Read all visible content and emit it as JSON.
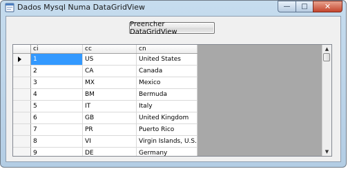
{
  "window": {
    "title": "Dados Mysql Numa DataGridView",
    "minimize_glyph": "—",
    "maximize_glyph": "□",
    "close_glyph": "✕"
  },
  "toolbar": {
    "fill_button_label": "Preencher DataGridView"
  },
  "grid": {
    "columns": [
      "ci",
      "cc",
      "cn"
    ],
    "current_row_index": 0,
    "rows": [
      [
        "1",
        "US",
        "United States"
      ],
      [
        "2",
        "CA",
        "Canada"
      ],
      [
        "3",
        "MX",
        "Mexico"
      ],
      [
        "4",
        "BM",
        "Bermuda"
      ],
      [
        "5",
        "IT",
        "Italy"
      ],
      [
        "6",
        "GB",
        "United Kingdom"
      ],
      [
        "7",
        "PR",
        "Puerto Rico"
      ],
      [
        "8",
        "VI",
        "Virgin Islands, U.S."
      ],
      [
        "9",
        "DE",
        "Germany"
      ]
    ]
  },
  "scrollbar": {
    "up_glyph": "▲",
    "down_glyph": "▼"
  }
}
